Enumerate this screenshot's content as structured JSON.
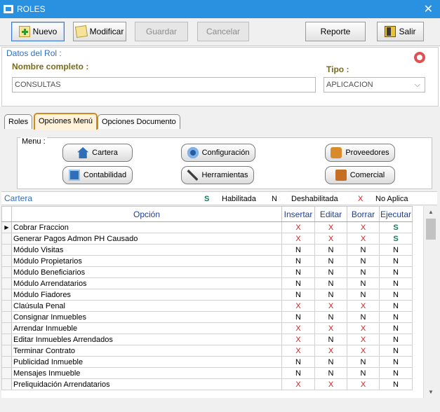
{
  "window": {
    "title": "ROLES"
  },
  "toolbar": {
    "nuevo": "Nuevo",
    "modificar": "Modificar",
    "guardar": "Guardar",
    "cancelar": "Cancelar",
    "reporte": "Reporte",
    "salir": "Salir"
  },
  "rol": {
    "section_title": "Datos del Rol :",
    "nombre_label": "Nombre completo :",
    "nombre_value": "CONSULTAS",
    "tipo_label": "Tipo :",
    "tipo_value": "APLICACION"
  },
  "tabs": [
    "Roles",
    "Opciones Menú",
    "Opciones Documento"
  ],
  "menu": {
    "label": "Menu :",
    "buttons": [
      "Cartera",
      "Configuración",
      "Proveedores",
      "Contabilidad",
      "Herramientas",
      "Comercial"
    ]
  },
  "grid_title": "Cartera",
  "legend": [
    {
      "code": "S",
      "text": "Habilitada",
      "color": "#127a56"
    },
    {
      "code": "N",
      "text": "Deshabilitada",
      "color": "#000000"
    },
    {
      "code": "X",
      "text": "No Aplica",
      "color": "#d01c1c"
    }
  ],
  "columns": [
    "Opción",
    "Insertar",
    "Editar",
    "Borrar",
    "Ejecutar"
  ],
  "rows": [
    {
      "opcion": "Cobrar Fraccion",
      "v": [
        "X",
        "X",
        "X",
        "S"
      ]
    },
    {
      "opcion": "Generar Pagos Admon PH Causado",
      "v": [
        "X",
        "X",
        "X",
        "S"
      ]
    },
    {
      "opcion": "Módulo Visitas",
      "v": [
        "N",
        "N",
        "N",
        "N"
      ]
    },
    {
      "opcion": "Módulo Propietarios",
      "v": [
        "N",
        "N",
        "N",
        "N"
      ]
    },
    {
      "opcion": "Módulo Beneficiarios",
      "v": [
        "N",
        "N",
        "N",
        "N"
      ]
    },
    {
      "opcion": "Módulo Arrendatarios",
      "v": [
        "N",
        "N",
        "N",
        "N"
      ]
    },
    {
      "opcion": "Módulo Fiadores",
      "v": [
        "N",
        "N",
        "N",
        "N"
      ]
    },
    {
      "opcion": "Claúsula Penal",
      "v": [
        "X",
        "X",
        "X",
        "N"
      ]
    },
    {
      "opcion": "Consignar Inmuebles",
      "v": [
        "N",
        "N",
        "N",
        "N"
      ]
    },
    {
      "opcion": "Arrendar Inmueble",
      "v": [
        "X",
        "X",
        "X",
        "N"
      ]
    },
    {
      "opcion": "Editar Inmuebles Arrendados",
      "v": [
        "X",
        "N",
        "X",
        "N"
      ]
    },
    {
      "opcion": "Terminar Contrato",
      "v": [
        "X",
        "X",
        "X",
        "N"
      ]
    },
    {
      "opcion": "Publicidad Inmueble",
      "v": [
        "N",
        "N",
        "N",
        "N"
      ]
    },
    {
      "opcion": "Mensajes Inmueble",
      "v": [
        "N",
        "N",
        "N",
        "N"
      ]
    },
    {
      "opcion": "Preliquidación Arrendatarios",
      "v": [
        "X",
        "X",
        "X",
        "N"
      ]
    }
  ],
  "colors": {
    "titlebar": "#2a91e0",
    "section_title": "#2e6fbf",
    "label_bold": "#7a6a1a",
    "no_aplica": "#d01c1c",
    "habilitada": "#127a56"
  }
}
